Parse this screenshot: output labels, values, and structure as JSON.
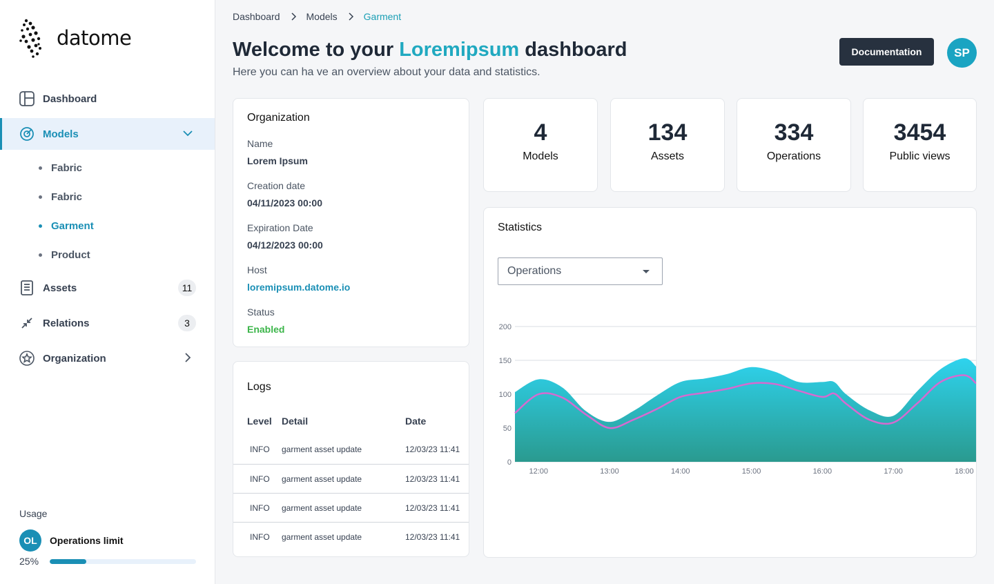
{
  "brand": {
    "name": "datome"
  },
  "sidebar": {
    "items": [
      {
        "label": "Dashboard",
        "icon": "layout-icon"
      },
      {
        "label": "Models",
        "icon": "target-icon",
        "active": true
      },
      {
        "label": "Assets",
        "icon": "document-icon",
        "badge": "11"
      },
      {
        "label": "Relations",
        "icon": "collapse-arrows-icon",
        "badge": "3"
      },
      {
        "label": "Organization",
        "icon": "star-badge-icon"
      }
    ],
    "models_sub": [
      "Fabric",
      "Fabric",
      "Garment",
      "Product"
    ],
    "models_sub_active": "Garment"
  },
  "usage": {
    "title": "Usage",
    "avatar": "OL",
    "label": "Operations limit",
    "percent_label": "25%",
    "percent": 25
  },
  "header": {
    "breadcrumb": [
      "Dashboard",
      "Models",
      "Garment"
    ],
    "title_prefix": "Welcome to your",
    "title_accent": "Loremipsum",
    "title_suffix": "dashboard",
    "subtitle": "Here you can ha ve an overview about your data and statistics.",
    "doc_button": "Documentation",
    "avatar": "SP"
  },
  "organization": {
    "title": "Organization",
    "fields": [
      {
        "label": "Name",
        "value": "Lorem Ipsum"
      },
      {
        "label": "Creation date",
        "value": "04/11/2023 00:00"
      },
      {
        "label": "Expiration Date",
        "value": "04/12/2023 00:00"
      },
      {
        "label": "Host",
        "value": "loremipsum.datome.io"
      },
      {
        "label": "Status",
        "value": "Enabled"
      }
    ]
  },
  "logs": {
    "title": "Logs",
    "columns": [
      "Level",
      "Detail",
      "Date"
    ],
    "rows": [
      [
        "INFO",
        "garment asset update",
        "12/03/23 11:41"
      ],
      [
        "INFO",
        "garment asset update",
        "12/03/23 11:41"
      ],
      [
        "INFO",
        "garment asset update",
        "12/03/23 11:41"
      ],
      [
        "INFO",
        "garment asset update",
        "12/03/23 11:41"
      ]
    ]
  },
  "stats": [
    {
      "value": "4",
      "label": "Models"
    },
    {
      "value": "134",
      "label": "Assets"
    },
    {
      "value": "334",
      "label": "Operations"
    },
    {
      "value": "3454",
      "label": "Public views"
    }
  ],
  "statistics": {
    "title": "Statistics",
    "select_value": "Operations"
  },
  "colors": {
    "accent": "#1a8fb5",
    "teal": "#20a9c0",
    "area_top": "#2ed3ee",
    "area_bottom": "#2a9a8f",
    "line": "#d66ad0",
    "success": "#3cb54a",
    "dark_button": "#27313f"
  },
  "chart_data": {
    "type": "area",
    "x": [
      "11:40",
      "12:00",
      "12:20",
      "12:40",
      "13:00",
      "13:20",
      "13:40",
      "14:00",
      "14:20",
      "14:40",
      "15:00",
      "15:20",
      "15:40",
      "16:00",
      "16:10",
      "16:20",
      "16:40",
      "17:00",
      "17:20",
      "17:40",
      "18:00",
      "18:10"
    ],
    "xticks": [
      "12:00",
      "13:00",
      "14:00",
      "15:00",
      "16:00",
      "17:00",
      "18:00"
    ],
    "yticks": [
      0,
      50,
      100,
      150,
      200
    ],
    "ylim": [
      0,
      200
    ],
    "grid": true,
    "series": [
      {
        "values": [
          103,
          122,
          110,
          75,
          59,
          75,
          98,
          118,
          123,
          130,
          140,
          133,
          118,
          118,
          118,
          100,
          76,
          68,
          104,
          137,
          153,
          141
        ]
      },
      {
        "values": [
          72,
          100,
          95,
          70,
          50,
          62,
          78,
          96,
          102,
          108,
          116,
          115,
          105,
          96,
          101,
          86,
          62,
          58,
          86,
          118,
          128,
          116
        ]
      }
    ]
  }
}
